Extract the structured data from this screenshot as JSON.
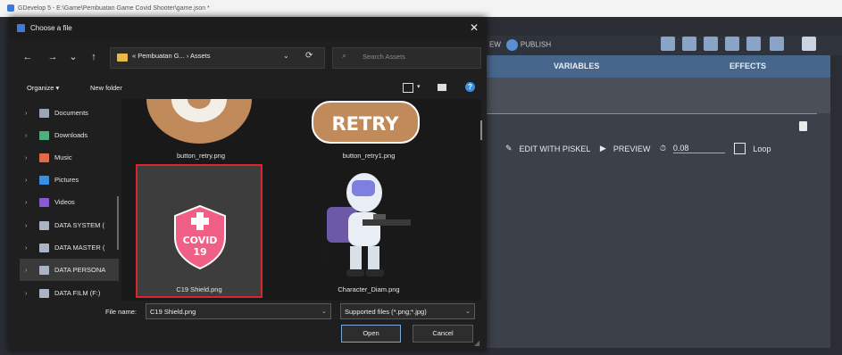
{
  "app": {
    "title": "GDevelop 5 - E:\\Game\\Pembuatan Game Covid Shooter\\game.json *",
    "publish_prefix": "EW",
    "publish_label": "PUBLISH",
    "tabs": [
      "VARIABLES",
      "EFFECTS"
    ],
    "editor_row": {
      "edit_label": "EDIT WITH PISKEL",
      "preview_label": "PREVIEW",
      "duration": "0.08",
      "loop_label": "Loop"
    }
  },
  "dialog": {
    "title": "Choose a file",
    "close": "✕",
    "nav": {
      "back": "←",
      "forward": "→",
      "down": "⌄",
      "up": "↑"
    },
    "address": {
      "path": "« Pembuatan G... › Assets",
      "chevron": "⌄",
      "refresh": "⟳"
    },
    "search_placeholder": "Search Assets",
    "organize_label": "Organize ▾",
    "new_folder_label": "New folder",
    "sidebar": [
      {
        "label": "Documents",
        "icon": "documents-icon",
        "color": "#9aa6b8"
      },
      {
        "label": "Downloads",
        "icon": "download-icon",
        "color": "#4caf7d"
      },
      {
        "label": "Music",
        "icon": "music-icon",
        "color": "#e06a4a"
      },
      {
        "label": "Pictures",
        "icon": "pictures-icon",
        "color": "#3b8fe0"
      },
      {
        "label": "Videos",
        "icon": "videos-icon",
        "color": "#8a5ad0"
      },
      {
        "label": "DATA SYSTEM (",
        "icon": "drive-icon",
        "color": "#aab4c4"
      },
      {
        "label": "DATA MASTER (",
        "icon": "drive-icon",
        "color": "#aab4c4"
      },
      {
        "label": "DATA PERSONA",
        "icon": "drive-icon",
        "color": "#aab4c4"
      },
      {
        "label": "DATA FILM (F:)",
        "icon": "drive-icon",
        "color": "#aab4c4"
      }
    ],
    "files": [
      {
        "name": "button_retry.png"
      },
      {
        "name": "button_retry1.png",
        "art_text": "RETRY"
      },
      {
        "name": "C19 Shield.png",
        "art_text_1": "COVID",
        "art_text_2": "19"
      },
      {
        "name": "Character_Diam.png"
      }
    ],
    "file_name_label": "File name:",
    "file_name_value": "C19 Shield.png",
    "file_type_value": "Supported files (*.png;*.jpg)",
    "open_label": "Open",
    "cancel_label": "Cancel"
  },
  "colors": {
    "accent_blue": "#46668c",
    "selection_red": "#d9262c",
    "retry_brown": "#c08a5a",
    "shield_pink": "#ef5f86"
  }
}
